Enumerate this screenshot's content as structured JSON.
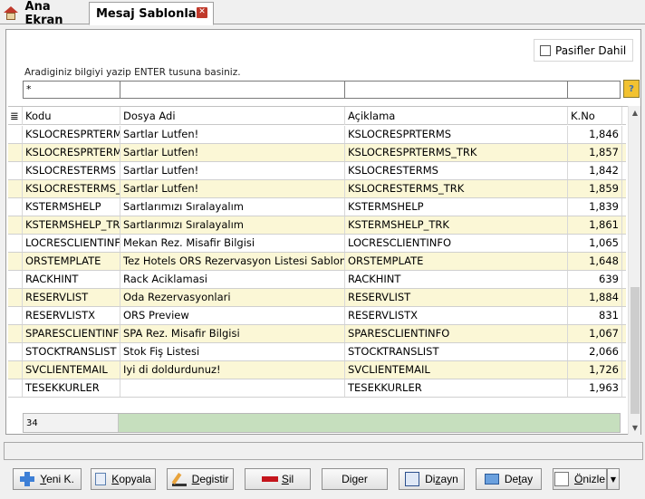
{
  "tabs": [
    {
      "label": "Ana Ekran",
      "icon": "home-icon"
    },
    {
      "label": "Mesaj Sablonlari",
      "icon": "close-icon"
    }
  ],
  "filter_panel": {
    "pasif_label": "Pasifler Dahil",
    "pasif_checked": false,
    "hint": "Aradiginiz bilgiyi yazip ENTER tusuna basiniz.",
    "inputs": [
      "*",
      "",
      "",
      ""
    ],
    "filter_icon": "filter-icon"
  },
  "grid": {
    "columns": [
      "Kodu",
      "Dosya Adi",
      "Açiklama",
      "K.No"
    ],
    "rows": [
      {
        "kodu": "KSLOCRESPRTERMS",
        "dosya": "Sartlar Lutfen!",
        "aciklama": "KSLOCRESPRTERMS",
        "kno": "1,846"
      },
      {
        "kodu": "KSLOCRESPRTERMS_TRK",
        "dosya": "Sartlar Lutfen!",
        "aciklama": "KSLOCRESPRTERMS_TRK",
        "kno": "1,857"
      },
      {
        "kodu": "KSLOCRESTERMS",
        "dosya": "Sartlar Lutfen!",
        "aciklama": "KSLOCRESTERMS",
        "kno": "1,842"
      },
      {
        "kodu": "KSLOCRESTERMS_TRK",
        "dosya": "Sartlar Lutfen!",
        "aciklama": "KSLOCRESTERMS_TRK",
        "kno": "1,859"
      },
      {
        "kodu": "KSTERMSHELP",
        "dosya": "Sartlarımızı Sıralayalım",
        "aciklama": "KSTERMSHELP",
        "kno": "1,839"
      },
      {
        "kodu": "KSTERMSHELP_TRK",
        "dosya": "Sartlarımızı Sıralayalım",
        "aciklama": "KSTERMSHELP_TRK",
        "kno": "1,861"
      },
      {
        "kodu": "LOCRESCLIENTINFO",
        "dosya": "Mekan Rez. Misafir Bilgisi",
        "aciklama": "LOCRESCLIENTINFO",
        "kno": "1,065"
      },
      {
        "kodu": "ORSTEMPLATE",
        "dosya": "Tez Hotels ORS Rezervasyon Listesi Sablon",
        "aciklama": "ORSTEMPLATE",
        "kno": "1,648"
      },
      {
        "kodu": "RACKHINT",
        "dosya": "Rack Aciklamasi",
        "aciklama": "RACKHINT",
        "kno": "639"
      },
      {
        "kodu": "RESERVLIST",
        "dosya": "Oda Rezervasyonlari",
        "aciklama": "RESERVLIST",
        "kno": "1,884"
      },
      {
        "kodu": "RESERVLISTX",
        "dosya": "ORS Preview",
        "aciklama": "RESERVLISTX",
        "kno": "831"
      },
      {
        "kodu": "SPARESCLIENTINFO",
        "dosya": "SPA Rez. Misafir Bilgisi",
        "aciklama": "SPARESCLIENTINFO",
        "kno": "1,067"
      },
      {
        "kodu": "STOCKTRANSLIST",
        "dosya": "Stok Fiş Listesi",
        "aciklama": "STOCKTRANSLIST",
        "kno": "2,066"
      },
      {
        "kodu": "SVCLIENTEMAIL",
        "dosya": "Iyi di doldurdunuz!",
        "aciklama": "SVCLIENTEMAIL",
        "kno": "1,726"
      },
      {
        "kodu": "TESEKKURLER",
        "dosya": "",
        "aciklama": "TESEKKURLER",
        "kno": "1,963"
      }
    ],
    "footer_count": "34"
  },
  "buttons": {
    "yeni_pre": "",
    "yeni_ul": "Y",
    "yeni_post": "eni K.",
    "kopyala_pre": "",
    "kopyala_ul": "K",
    "kopyala_post": "opyala",
    "degistir_pre": "",
    "degistir_ul": "D",
    "degistir_post": "egistir",
    "sil_pre": "",
    "sil_ul": "S",
    "sil_post": "il",
    "diger_pre": "Di",
    "diger_ul": "g",
    "diger_post": "er",
    "dizayn_pre": "Di",
    "dizayn_ul": "z",
    "dizayn_post": "ayn",
    "detay_pre": "De",
    "detay_ul": "t",
    "detay_post": "ay",
    "onizle_pre": "",
    "onizle_ul": "Ö",
    "onizle_post": "nizle"
  }
}
